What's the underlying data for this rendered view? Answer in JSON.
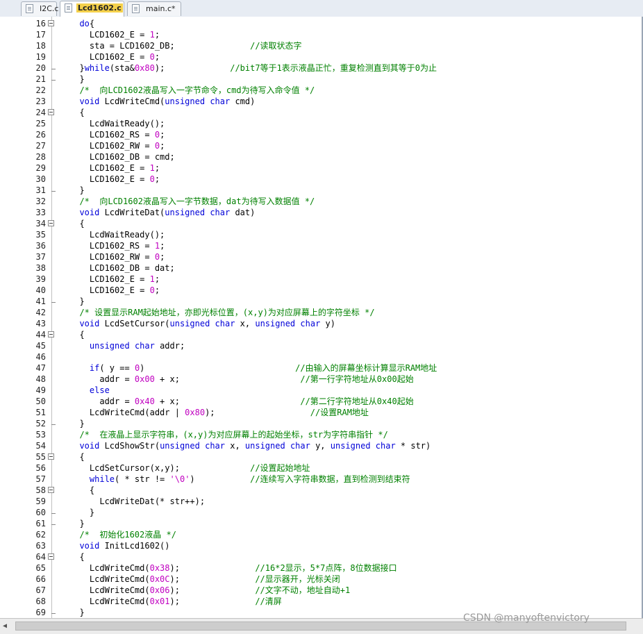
{
  "tabs": [
    {
      "label": "I2C.c",
      "active": false
    },
    {
      "label": "Lcd1602.c",
      "active": true
    },
    {
      "label": "main.c*",
      "active": false
    }
  ],
  "colors": {
    "keyword": "#0000d8",
    "number": "#c000c0",
    "comment": "#008000",
    "text": "#000000"
  },
  "lines": [
    {
      "num": "16",
      "fold": "start",
      "tokens": [
        [
          "",
          "  "
        ],
        [
          "k",
          "do"
        ],
        [
          "",
          "{"
        ]
      ]
    },
    {
      "num": "17",
      "fold": "",
      "tokens": [
        [
          "",
          "    LCD1602_E = "
        ],
        [
          "n",
          "1"
        ],
        [
          "",
          ";"
        ]
      ]
    },
    {
      "num": "18",
      "fold": "",
      "tokens": [
        [
          "",
          "    sta = LCD1602_DB;               "
        ],
        [
          "c",
          "//读取状态字"
        ]
      ]
    },
    {
      "num": "19",
      "fold": "",
      "tokens": [
        [
          "",
          "    LCD1602_E = "
        ],
        [
          "n",
          "0"
        ],
        [
          "",
          ";"
        ]
      ]
    },
    {
      "num": "20",
      "fold": "end",
      "tokens": [
        [
          "",
          "  }"
        ],
        [
          "k",
          "while"
        ],
        [
          "",
          "(sta&"
        ],
        [
          "n",
          "0x80"
        ],
        [
          "",
          ");             "
        ],
        [
          "c",
          "//bit7等于1表示液晶正忙，重复检测直到其等于0为止"
        ]
      ]
    },
    {
      "num": "21",
      "fold": "end",
      "tokens": [
        [
          "",
          "  }"
        ]
      ]
    },
    {
      "num": "22",
      "fold": "",
      "tokens": [
        [
          "c",
          "  /*  向LCD1602液晶写入一字节命令，cmd为待写入命令值 */"
        ]
      ]
    },
    {
      "num": "23",
      "fold": "",
      "tokens": [
        [
          "",
          "  "
        ],
        [
          "k",
          "void"
        ],
        [
          "",
          " LcdWriteCmd("
        ],
        [
          "k",
          "unsigned"
        ],
        [
          "",
          " "
        ],
        [
          "k",
          "char"
        ],
        [
          "",
          " cmd)"
        ]
      ]
    },
    {
      "num": "24",
      "fold": "start",
      "tokens": [
        [
          "",
          "  {"
        ]
      ]
    },
    {
      "num": "25",
      "fold": "",
      "tokens": [
        [
          "",
          "    LcdWaitReady();"
        ]
      ]
    },
    {
      "num": "26",
      "fold": "",
      "tokens": [
        [
          "",
          "    LCD1602_RS = "
        ],
        [
          "n",
          "0"
        ],
        [
          "",
          ";"
        ]
      ]
    },
    {
      "num": "27",
      "fold": "",
      "tokens": [
        [
          "",
          "    LCD1602_RW = "
        ],
        [
          "n",
          "0"
        ],
        [
          "",
          ";"
        ]
      ]
    },
    {
      "num": "28",
      "fold": "",
      "tokens": [
        [
          "",
          "    LCD1602_DB = cmd;"
        ]
      ]
    },
    {
      "num": "29",
      "fold": "",
      "tokens": [
        [
          "",
          "    LCD1602_E = "
        ],
        [
          "n",
          "1"
        ],
        [
          "",
          ";"
        ]
      ]
    },
    {
      "num": "30",
      "fold": "",
      "tokens": [
        [
          "",
          "    LCD1602_E = "
        ],
        [
          "n",
          "0"
        ],
        [
          "",
          ";"
        ]
      ]
    },
    {
      "num": "31",
      "fold": "end",
      "tokens": [
        [
          "",
          "  }"
        ]
      ]
    },
    {
      "num": "32",
      "fold": "",
      "tokens": [
        [
          "c",
          "  /*  向LCD1602液晶写入一字节数据，dat为待写入数据值 */"
        ]
      ]
    },
    {
      "num": "33",
      "fold": "",
      "tokens": [
        [
          "",
          "  "
        ],
        [
          "k",
          "void"
        ],
        [
          "",
          " LcdWriteDat("
        ],
        [
          "k",
          "unsigned"
        ],
        [
          "",
          " "
        ],
        [
          "k",
          "char"
        ],
        [
          "",
          " dat)"
        ]
      ]
    },
    {
      "num": "34",
      "fold": "start",
      "tokens": [
        [
          "",
          "  {"
        ]
      ]
    },
    {
      "num": "35",
      "fold": "",
      "tokens": [
        [
          "",
          "    LcdWaitReady();"
        ]
      ]
    },
    {
      "num": "36",
      "fold": "",
      "tokens": [
        [
          "",
          "    LCD1602_RS = "
        ],
        [
          "n",
          "1"
        ],
        [
          "",
          ";"
        ]
      ]
    },
    {
      "num": "37",
      "fold": "",
      "tokens": [
        [
          "",
          "    LCD1602_RW = "
        ],
        [
          "n",
          "0"
        ],
        [
          "",
          ";"
        ]
      ]
    },
    {
      "num": "38",
      "fold": "",
      "tokens": [
        [
          "",
          "    LCD1602_DB = dat;"
        ]
      ]
    },
    {
      "num": "39",
      "fold": "",
      "tokens": [
        [
          "",
          "    LCD1602_E = "
        ],
        [
          "n",
          "1"
        ],
        [
          "",
          ";"
        ]
      ]
    },
    {
      "num": "40",
      "fold": "",
      "tokens": [
        [
          "",
          "    LCD1602_E = "
        ],
        [
          "n",
          "0"
        ],
        [
          "",
          ";"
        ]
      ]
    },
    {
      "num": "41",
      "fold": "end",
      "tokens": [
        [
          "",
          "  }"
        ]
      ]
    },
    {
      "num": "42",
      "fold": "",
      "tokens": [
        [
          "c",
          "  /* 设置显示RAM起始地址，亦即光标位置，(x,y)为对应屏幕上的字符坐标 */"
        ]
      ]
    },
    {
      "num": "43",
      "fold": "",
      "tokens": [
        [
          "",
          "  "
        ],
        [
          "k",
          "void"
        ],
        [
          "",
          " LcdSetCursor("
        ],
        [
          "k",
          "unsigned"
        ],
        [
          "",
          " "
        ],
        [
          "k",
          "char"
        ],
        [
          "",
          " x, "
        ],
        [
          "k",
          "unsigned"
        ],
        [
          "",
          " "
        ],
        [
          "k",
          "char"
        ],
        [
          "",
          " y)"
        ]
      ]
    },
    {
      "num": "44",
      "fold": "start",
      "tokens": [
        [
          "",
          "  {"
        ]
      ]
    },
    {
      "num": "45",
      "fold": "",
      "tokens": [
        [
          "",
          "    "
        ],
        [
          "k",
          "unsigned"
        ],
        [
          "",
          " "
        ],
        [
          "k",
          "char"
        ],
        [
          "",
          " addr;"
        ]
      ]
    },
    {
      "num": "46",
      "fold": "",
      "tokens": [
        [
          "",
          ""
        ]
      ]
    },
    {
      "num": "47",
      "fold": "",
      "tokens": [
        [
          "",
          "    "
        ],
        [
          "k",
          "if"
        ],
        [
          "",
          "( y == "
        ],
        [
          "n",
          "0"
        ],
        [
          "",
          ")                              "
        ],
        [
          "c",
          "//由输入的屏幕坐标计算显示RAM地址"
        ]
      ]
    },
    {
      "num": "48",
      "fold": "",
      "tokens": [
        [
          "",
          "      addr = "
        ],
        [
          "n",
          "0x00"
        ],
        [
          "",
          " + x;                        "
        ],
        [
          "c",
          "//第一行字符地址从0x00起始"
        ]
      ]
    },
    {
      "num": "49",
      "fold": "",
      "tokens": [
        [
          "",
          "    "
        ],
        [
          "k",
          "else"
        ]
      ]
    },
    {
      "num": "50",
      "fold": "",
      "tokens": [
        [
          "",
          "      addr = "
        ],
        [
          "n",
          "0x40"
        ],
        [
          "",
          " + x;                        "
        ],
        [
          "c",
          "//第二行字符地址从0x40起始"
        ]
      ]
    },
    {
      "num": "51",
      "fold": "",
      "tokens": [
        [
          "",
          "    LcdWriteCmd(addr | "
        ],
        [
          "n",
          "0x80"
        ],
        [
          "",
          ");                   "
        ],
        [
          "c",
          "//设置RAM地址"
        ]
      ]
    },
    {
      "num": "52",
      "fold": "end",
      "tokens": [
        [
          "",
          "  }"
        ]
      ]
    },
    {
      "num": "53",
      "fold": "",
      "tokens": [
        [
          "c",
          "  /*  在液晶上显示字符串，(x,y)为对应屏幕上的起始坐标，str为字符串指针 */"
        ]
      ]
    },
    {
      "num": "54",
      "fold": "",
      "tokens": [
        [
          "",
          "  "
        ],
        [
          "k",
          "void"
        ],
        [
          "",
          " LcdShowStr("
        ],
        [
          "k",
          "unsigned"
        ],
        [
          "",
          " "
        ],
        [
          "k",
          "char"
        ],
        [
          "",
          " x, "
        ],
        [
          "k",
          "unsigned"
        ],
        [
          "",
          " "
        ],
        [
          "k",
          "char"
        ],
        [
          "",
          " y, "
        ],
        [
          "k",
          "unsigned"
        ],
        [
          "",
          " "
        ],
        [
          "k",
          "char"
        ],
        [
          "",
          " * str)"
        ]
      ]
    },
    {
      "num": "55",
      "fold": "start",
      "tokens": [
        [
          "",
          "  {"
        ]
      ]
    },
    {
      "num": "56",
      "fold": "",
      "tokens": [
        [
          "",
          "    LcdSetCursor(x,y);              "
        ],
        [
          "c",
          "//设置起始地址"
        ]
      ]
    },
    {
      "num": "57",
      "fold": "",
      "tokens": [
        [
          "",
          "    "
        ],
        [
          "k",
          "while"
        ],
        [
          "",
          "( * str != "
        ],
        [
          "n",
          "'\\0'"
        ],
        [
          "",
          ")           "
        ],
        [
          "c",
          "//连续写入字符串数据，直到检测到结束符"
        ]
      ]
    },
    {
      "num": "58",
      "fold": "start",
      "tokens": [
        [
          "",
          "    {"
        ]
      ]
    },
    {
      "num": "59",
      "fold": "",
      "tokens": [
        [
          "",
          "      LcdWriteDat(* str++);"
        ]
      ]
    },
    {
      "num": "60",
      "fold": "end",
      "tokens": [
        [
          "",
          "    }"
        ]
      ]
    },
    {
      "num": "61",
      "fold": "end",
      "tokens": [
        [
          "",
          "  }"
        ]
      ]
    },
    {
      "num": "62",
      "fold": "",
      "tokens": [
        [
          "c",
          "  /*  初始化1602液晶 */"
        ]
      ]
    },
    {
      "num": "63",
      "fold": "",
      "tokens": [
        [
          "",
          "  "
        ],
        [
          "k",
          "void"
        ],
        [
          "",
          " InitLcd1602()"
        ]
      ]
    },
    {
      "num": "64",
      "fold": "start",
      "tokens": [
        [
          "",
          "  {"
        ]
      ]
    },
    {
      "num": "65",
      "fold": "",
      "tokens": [
        [
          "",
          "    LcdWriteCmd("
        ],
        [
          "n",
          "0x38"
        ],
        [
          "",
          ");               "
        ],
        [
          "c",
          "//16*2显示，5*7点阵，8位数据接口"
        ]
      ]
    },
    {
      "num": "66",
      "fold": "",
      "tokens": [
        [
          "",
          "    LcdWriteCmd("
        ],
        [
          "n",
          "0x0C"
        ],
        [
          "",
          ");               "
        ],
        [
          "c",
          "//显示器开，光标关闭"
        ]
      ]
    },
    {
      "num": "67",
      "fold": "",
      "tokens": [
        [
          "",
          "    LcdWriteCmd("
        ],
        [
          "n",
          "0x06"
        ],
        [
          "",
          ");               "
        ],
        [
          "c",
          "//文字不动，地址自动+1"
        ]
      ]
    },
    {
      "num": "68",
      "fold": "",
      "tokens": [
        [
          "",
          "    LcdWriteCmd("
        ],
        [
          "n",
          "0x01"
        ],
        [
          "",
          ");               "
        ],
        [
          "c",
          "//清屏"
        ]
      ]
    },
    {
      "num": "69",
      "fold": "end",
      "tokens": [
        [
          "",
          "  }"
        ]
      ]
    }
  ],
  "watermark": "CSDN @manyoftenvictory"
}
